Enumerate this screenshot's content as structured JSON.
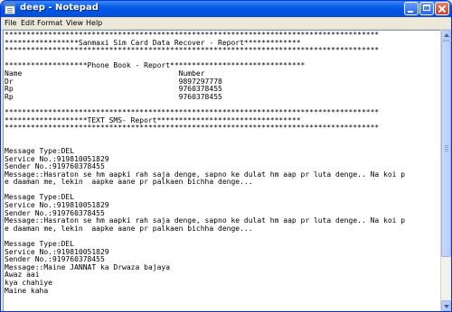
{
  "window": {
    "title": "deep - Notepad",
    "minimize_icon": "minimize-icon",
    "maximize_icon": "maximize-icon",
    "close_icon": "close-icon",
    "app_icon": "notepad-icon"
  },
  "menu": {
    "file": "File",
    "edit": "Edit",
    "format": "Format",
    "view": "View",
    "help": "Help"
  },
  "editor": {
    "lines": [
      "**************************************************************************************",
      "*****************Sanmaxi Sim Card Data Recover - Report*************",
      "**************************************************************************************",
      "",
      "*******************Phone Book - Report*******************************",
      "Name                                    Number",
      "Dr                                      9897297778",
      "Rp                                      9760378455",
      "Rp                                      9760378455",
      "",
      "**************************************************************************************",
      "*******************TEXT SMS- Report*********************************",
      "**************************************************************************************",
      "",
      "",
      "Message Type:DEL",
      "Service No.:919810051829",
      "Sender No.:919760378455",
      "Message::Hasraton se hm aapki rah saja denge, sapno ke dulat hm aap pr luta denge.. Na koi p",
      "e daaman me, lekin  aapke aane pr palkaen bichha denge...",
      "",
      "Message Type:DEL",
      "Service No.:919810051829",
      "Sender No.:919760378455",
      "Message::Hasraton se hm aapki rah saja denge, sapno ke dulat hm aap pr luta denge.. Na koi p",
      "e daaman me, lekin  aapke aane pr palkaen bichha denge...",
      "",
      "Message Type:DEL",
      "Service No.:919810051829",
      "Sender No.:919760378455",
      "Message::Maine JANNAT ka Drwaza bajaya",
      "Awaz aai",
      "kya chahiye",
      "Maine kaha"
    ]
  },
  "scrollbar": {
    "position": 0.0
  }
}
